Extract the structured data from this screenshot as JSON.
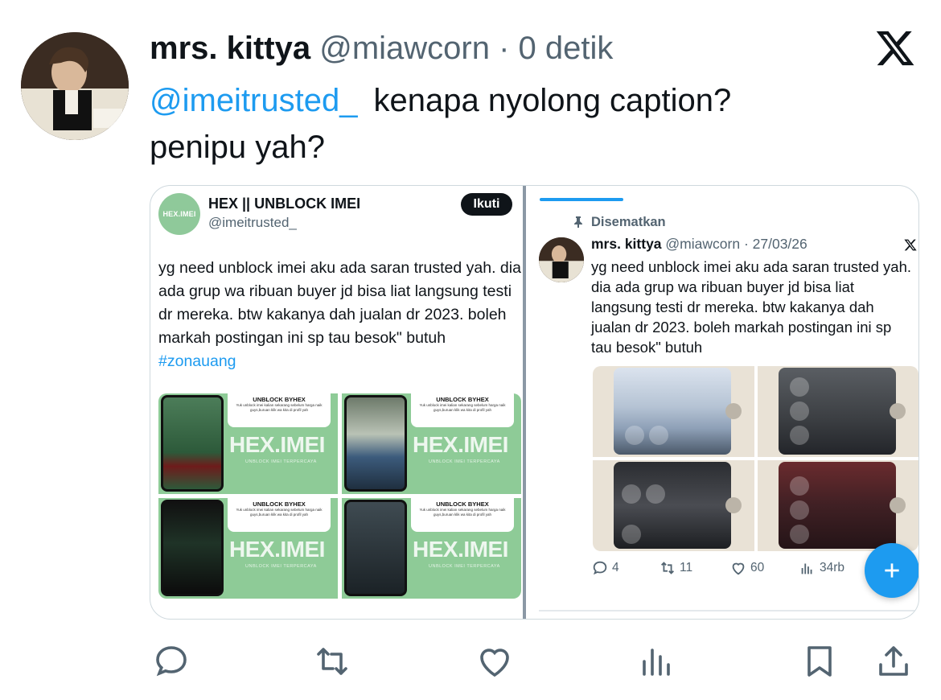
{
  "tweet": {
    "author_name": "mrs. kittya",
    "author_handle": "@miawcorn",
    "time_sep": " · ",
    "time": "0 detik",
    "mention": "@imeitrusted_",
    "text_line1": "kenapa nyolong caption?",
    "text_line2": "penipu yah?"
  },
  "left_post": {
    "avatar_text": "HEX.IMEI",
    "name": "HEX || UNBLOCK IMEI",
    "handle": "@imeitrusted_",
    "follow_label": "Ikuti",
    "text": "yg need unblock imei aku ada saran trusted yah. dia ada grup wa ribuan buyer jd bisa liat langsung testi dr mereka. btw kakanya dah jualan dr 2023. boleh markah postingan ini sp tau besok\" butuh",
    "hashtag": "#zonauang",
    "promo_title": "UNBLOCK BYHEX",
    "promo_desc": "Yuk unblock imei kalian sekarang sebelum harga naik guys,buruan klik wa kita di profil yah",
    "promo_brand": "HEX.IMEI",
    "promo_sub": "UNBLOCK IMEI TERPERCAYA"
  },
  "right_post": {
    "pinned_label": "Disematkan",
    "name": "mrs. kittya",
    "handle": "@miawcorn",
    "date_sep": " · ",
    "date": "27/03/26",
    "text": "yg need unblock imei aku ada saran trusted yah. dia ada grup wa ribuan buyer jd bisa liat langsung testi dr mereka. btw kakanya dah jualan dr 2023. boleh markah postingan ini sp tau besok\" butuh",
    "replies": "4",
    "reposts": "11",
    "likes": "60",
    "views": "34rb"
  },
  "colors": {
    "accent": "#1d9bf0",
    "text": "#0f1419",
    "muted": "#536471",
    "promo_green": "#8ecb97"
  },
  "icons": [
    "x-logo-icon",
    "reply-icon",
    "repost-icon",
    "like-icon",
    "views-icon",
    "bookmark-icon",
    "share-icon",
    "pin-icon",
    "plus-icon"
  ]
}
